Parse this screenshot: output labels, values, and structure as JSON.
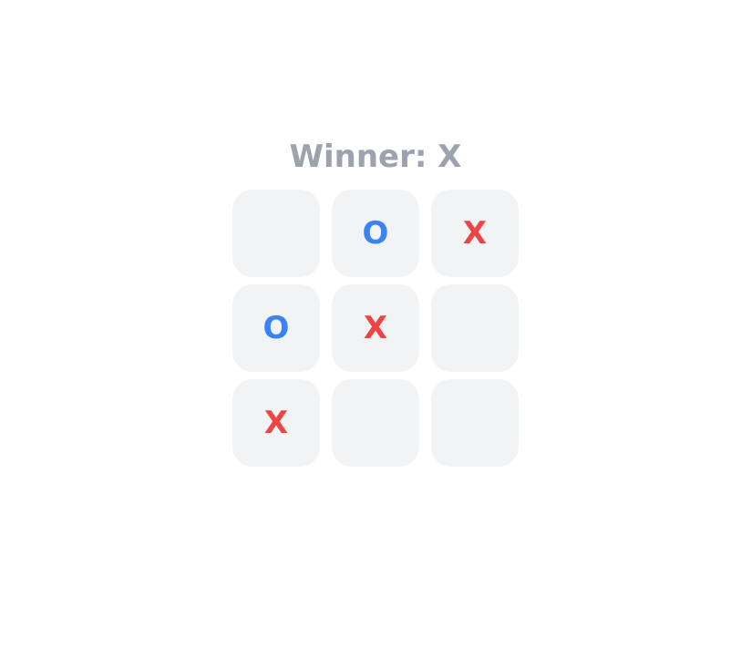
{
  "status": {
    "text": "Winner: X"
  },
  "board": {
    "cells": [
      {
        "mark": ""
      },
      {
        "mark": "O"
      },
      {
        "mark": "X"
      },
      {
        "mark": "O"
      },
      {
        "mark": "X"
      },
      {
        "mark": ""
      },
      {
        "mark": "X"
      },
      {
        "mark": ""
      },
      {
        "mark": ""
      }
    ]
  },
  "colors": {
    "x": "#ef4444",
    "o": "#3b82f6",
    "status": "#9ca3af",
    "cell_bg": "#f2f3f5"
  }
}
